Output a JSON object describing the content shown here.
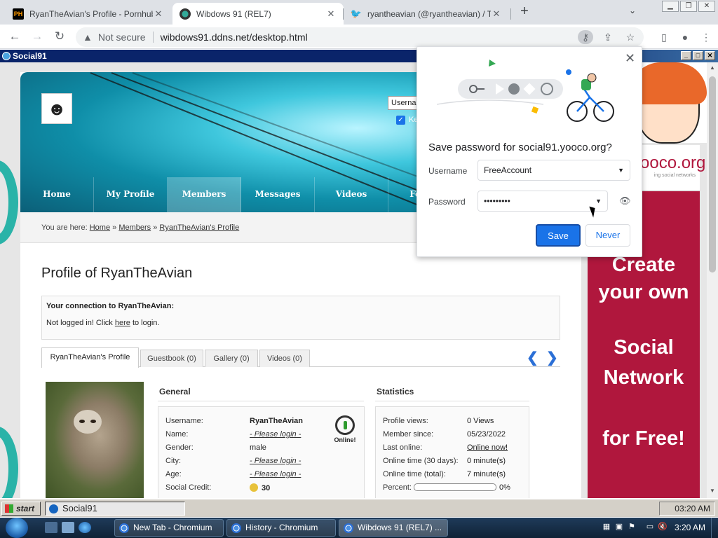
{
  "browser": {
    "tabs": [
      {
        "favicon": "PH",
        "title": "RyanTheAvian's Profile - Pornhub",
        "active": false
      },
      {
        "favicon": "ball",
        "title": "Wibdows 91 (REL7)",
        "active": true
      },
      {
        "favicon": "twitter-bird",
        "title": "ryantheavian (@ryantheavian) / T",
        "active": false
      }
    ],
    "new_tab": "+",
    "tab_list": "⌄",
    "not_secure": "Not secure",
    "url": "wibdows91.ddns.net/desktop.html"
  },
  "w91": {
    "title": "Social91",
    "start": "start",
    "app_button": "Social91",
    "clock": "03:20 AM"
  },
  "site": {
    "login_placeholder": "Userna",
    "keep_label": "Ke",
    "nav": [
      "Home",
      "My Profile",
      "Members",
      "Messages",
      "Videos",
      "Forum"
    ],
    "nav_active": "Members",
    "breadcrumb": {
      "prefix": "You are here:",
      "items": [
        "Home",
        "Members",
        "RyanTheAvian's Profile"
      ],
      "sep": "»"
    },
    "page_title": "Profile of RyanTheAvian",
    "connection": {
      "title": "Your connection to RyanTheAvian:",
      "text_before": "Not logged in! Click",
      "link": "here",
      "text_after": "to login."
    },
    "profile_tabs": [
      "RyanTheAvian's Profile",
      "Guestbook (0)",
      "Gallery (0)",
      "Videos (0)"
    ],
    "general": {
      "heading": "General",
      "rows": [
        {
          "k": "Username:",
          "v": "RyanTheAvian"
        },
        {
          "k": "Name:",
          "v": "- Please login -"
        },
        {
          "k": "Gender:",
          "v": "male"
        },
        {
          "k": "City:",
          "v": "- Please login -"
        },
        {
          "k": "Age:",
          "v": "- Please login -"
        },
        {
          "k": "Social Credit:",
          "v": "30"
        }
      ],
      "online_label": "Online!"
    },
    "statistics": {
      "heading": "Statistics",
      "rows": [
        {
          "k": "Profile views:",
          "v": "0 Views"
        },
        {
          "k": "Member since:",
          "v": "05/23/2022"
        },
        {
          "k": "Last online:",
          "v": "Online now!"
        },
        {
          "k": "Online time (30 days):",
          "v": "0 minute(s)"
        },
        {
          "k": "Online time (total):",
          "v": "7 minute(s)"
        },
        {
          "k": "Percent:",
          "v": "0%"
        }
      ],
      "percent_fill": 0
    }
  },
  "ad": {
    "logo": "ooco.org",
    "logo_sub": "ing social networks",
    "lines": [
      "Create",
      "your own",
      "Social",
      "Network",
      "for Free!"
    ]
  },
  "password_bubble": {
    "title": "Save password for social91.yooco.org?",
    "username_label": "Username",
    "username_value": "FreeAccount",
    "password_label": "Password",
    "password_value": "•••••••••",
    "save": "Save",
    "never": "Never"
  },
  "win7": {
    "buttons": [
      "New Tab - Chromium",
      "History - Chromium",
      "Wibdows 91 (REL7) ..."
    ],
    "clock": "3:20 AM"
  }
}
